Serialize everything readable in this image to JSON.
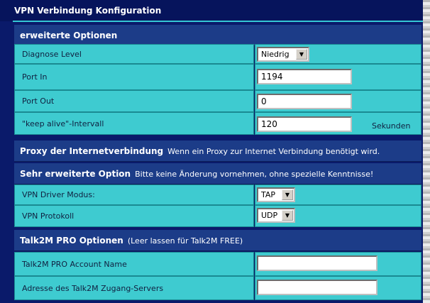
{
  "window": {
    "title": "VPN Verbindung Konfiguration"
  },
  "sections": {
    "erweitert": {
      "title": "erweiterte Optionen"
    },
    "proxy": {
      "title": "Proxy der Internetverbindung",
      "note": "Wenn ein Proxy zur Internet Verbindung benötigt wird."
    },
    "sehr_erweitert": {
      "title": "Sehr erweiterte Option",
      "note": "Bitte keine Änderung vornehmen, ohne spezielle Kenntnisse!"
    },
    "talk2m": {
      "title": "Talk2M PRO Optionen",
      "note": "(Leer lassen für Talk2M FREE)"
    }
  },
  "fields": {
    "diagnose": {
      "label": "Diagnose Level",
      "value": "Niedrig"
    },
    "port_in": {
      "label": "Port In",
      "value": "1194"
    },
    "port_out": {
      "label": "Port Out",
      "value": "0"
    },
    "keepalive": {
      "label": "\"keep alive\"-Intervall",
      "value": "120",
      "unit": "Sekunden"
    },
    "driver": {
      "label": "VPN Driver Modus:",
      "value": "TAP"
    },
    "protokoll": {
      "label": "VPN Protokoll",
      "value": "UDP"
    },
    "account": {
      "label": "Talk2M PRO Account Name",
      "value": ""
    },
    "server": {
      "label": "Adresse des Talk2M Zugang-Servers",
      "value": ""
    }
  },
  "icons": {
    "dropdown": "chevron-down-icon"
  },
  "colors": {
    "panel": "#0a1a6a",
    "section": "#1c3c88",
    "row": "#3ecbd0",
    "accent_line": "#34c8d4"
  }
}
